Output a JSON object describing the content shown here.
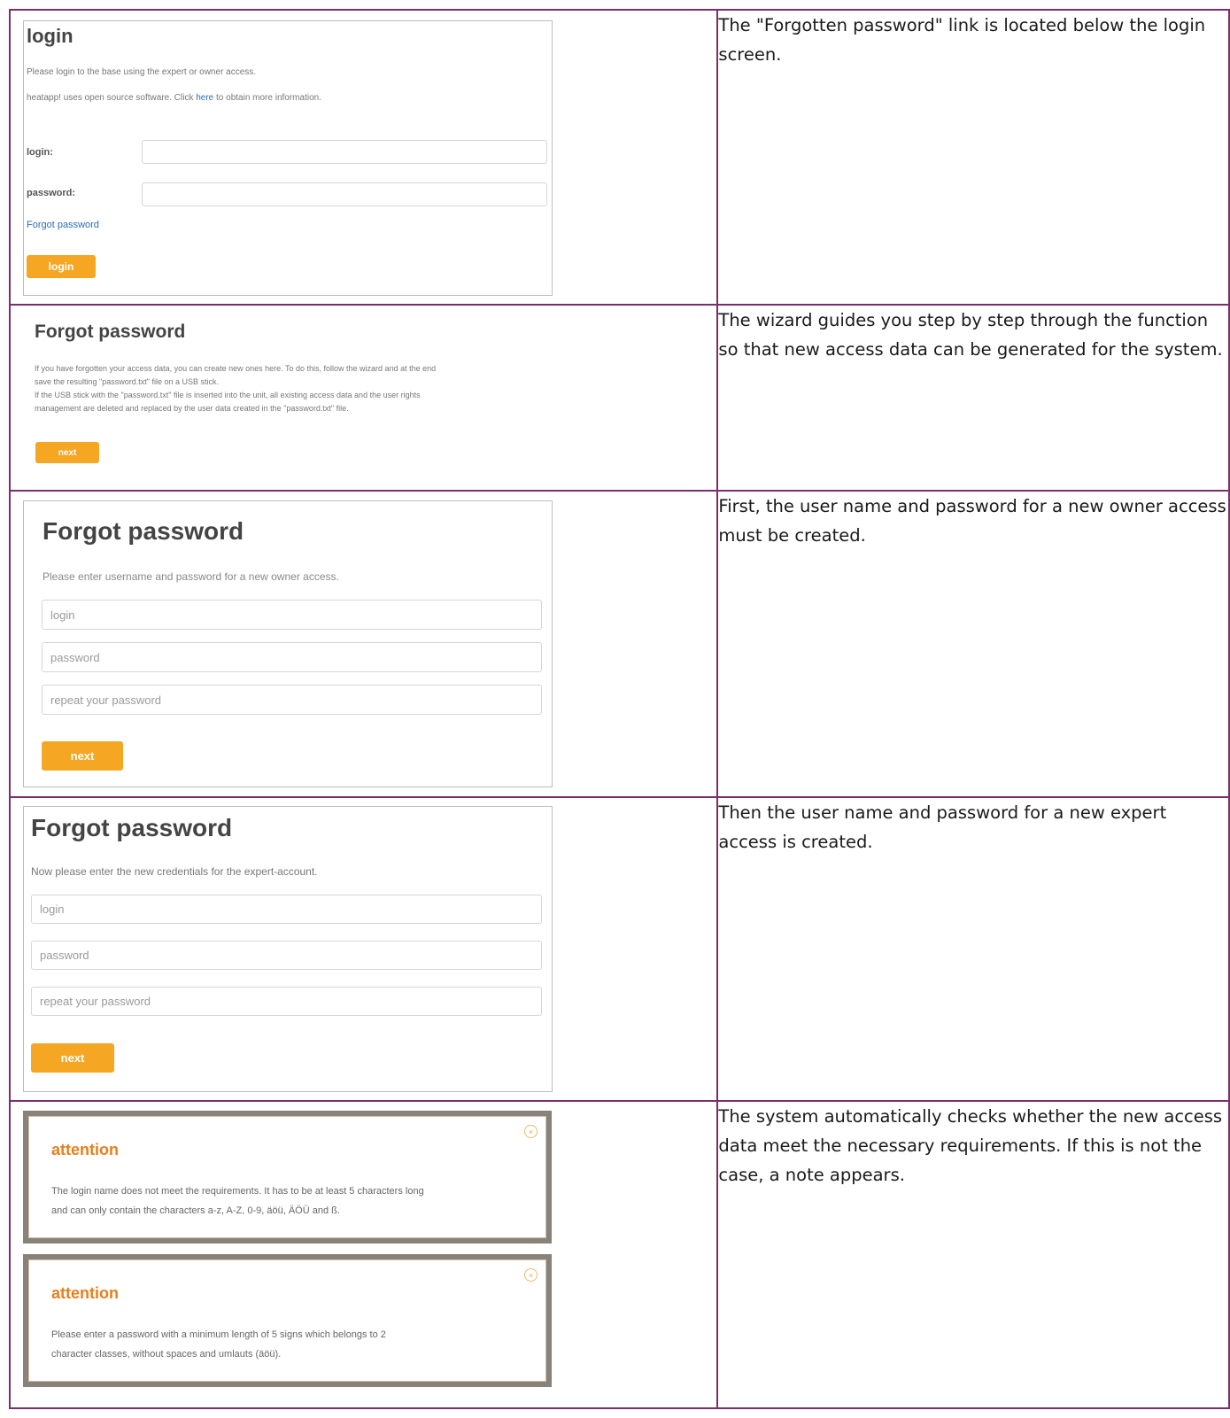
{
  "rows": [
    {
      "description": "The \"Forgotten password\" link is located below the login screen.",
      "login_screen": {
        "title": "login",
        "intro": "Please login to the base using the expert or owner access.",
        "opensource_pre": "heatapp! uses open source software. Click",
        "opensource_link": "here",
        "opensource_post": "to obtain more information.",
        "login_label": "login:",
        "password_label": "password:",
        "forgot_link": "Forgot password",
        "login_button": "login"
      }
    },
    {
      "description": "The wizard guides you step by step through the function so that new access data can be generated for the system.",
      "wizard_intro": {
        "title": "Forgot password",
        "line1": "If you have forgotten your access data, you can create new ones here. To do this, follow the wizard and at the end",
        "line2": "save the resulting \"password.txt\" file on a USB stick.",
        "line3": "If the USB stick with the \"password.txt\" file is inserted into the unit, all existing access data and the user rights",
        "line4": "management are deleted and replaced by the user data created in the \"password.txt\" file.",
        "next_button": "next"
      }
    },
    {
      "description": "First, the user name and password for a new owner access must be created.",
      "owner_form": {
        "title": "Forgot password",
        "instruction": "Please enter username and password for a new owner access.",
        "login_placeholder": "login",
        "password_placeholder": "password",
        "repeat_placeholder": "repeat your password",
        "next_button": "next"
      }
    },
    {
      "description": "Then the user name and password for a new expert access is created.",
      "expert_form": {
        "title": "Forgot password",
        "instruction": "Now please enter the new credentials for the expert-account.",
        "login_placeholder": "login",
        "password_placeholder": "password",
        "repeat_placeholder": "repeat your password",
        "next_button": "next"
      }
    },
    {
      "description": "The system automatically checks whether the new access data meet the necessary requirements. If this is not the case, a note appears.",
      "attention_login": {
        "title": "attention",
        "line1": "The login name does not meet the requirements. It has to be at least 5 characters long",
        "line2": "and can only contain the characters a-z, A-Z, 0-9, äöü, ÄÖÜ and ß."
      },
      "attention_password": {
        "title": "attention",
        "line1": "Please enter a password with a minimum length of 5 signs which belongs to 2",
        "line2": "character classes, without spaces and umlauts (äöü)."
      }
    }
  ]
}
